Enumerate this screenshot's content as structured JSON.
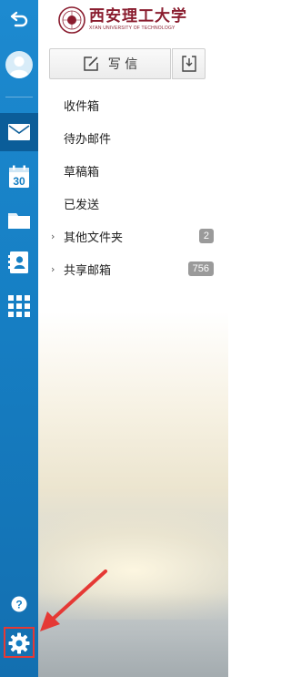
{
  "rail": {
    "items": [
      {
        "name": "back-icon"
      },
      {
        "name": "avatar"
      },
      {
        "name": "mail-icon"
      },
      {
        "name": "calendar-icon",
        "text": "30"
      },
      {
        "name": "folder-icon"
      },
      {
        "name": "contacts-icon"
      },
      {
        "name": "apps-icon"
      },
      {
        "name": "help-icon"
      },
      {
        "name": "settings-icon"
      }
    ]
  },
  "brand": {
    "name_cn": "西安理工大学",
    "name_en": "XI'AN UNIVERSITY OF TECHNOLOGY",
    "color": "#8a1d2f"
  },
  "toolbar": {
    "compose_label": "写 信"
  },
  "folders": [
    {
      "label": "收件箱"
    },
    {
      "label": "待办邮件"
    },
    {
      "label": "草稿箱"
    },
    {
      "label": "已发送"
    },
    {
      "label": "其他文件夹",
      "expandable": true,
      "count": "2"
    },
    {
      "label": "共享邮箱",
      "expandable": true,
      "count": "756"
    }
  ],
  "colors": {
    "rail": "#1b86cc",
    "rail_active": "#0b5d99",
    "highlight": "#e53935"
  }
}
